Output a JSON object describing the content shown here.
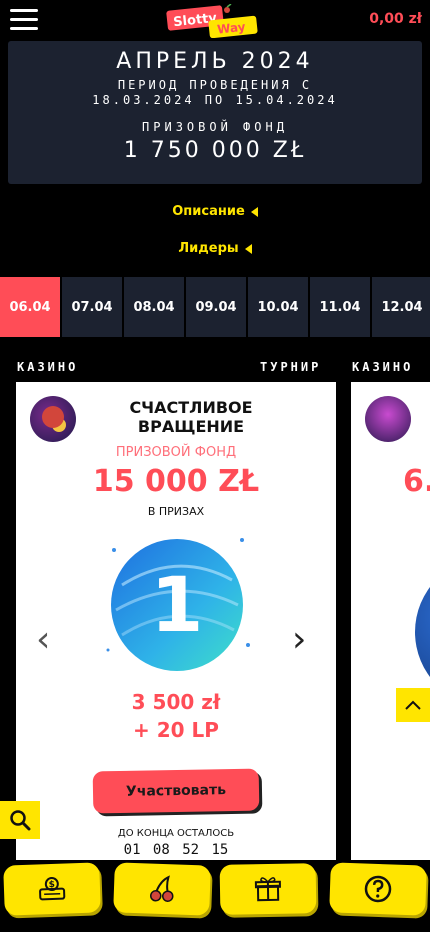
{
  "header": {
    "menu_icon": "hamburger-icon",
    "logo_text": "Slotty Way",
    "balance": "0,00 zł"
  },
  "banner": {
    "month": "АПРЕЛЬ 2024",
    "period_line1": "ПЕРИОД ПРОВЕДЕНИЯ С",
    "period_line2": "18.03.2024 ПО 15.04.2024",
    "fund_label": "ПРИЗОВОЙ ФОНД",
    "fund_value": "1 750 000 ZŁ"
  },
  "links": {
    "description": "Описание",
    "leaders": "Лидеры"
  },
  "date_tabs": [
    {
      "label": "06.04",
      "active": true
    },
    {
      "label": "07.04",
      "active": false
    },
    {
      "label": "08.04",
      "active": false
    },
    {
      "label": "09.04",
      "active": false
    },
    {
      "label": "10.04",
      "active": false
    },
    {
      "label": "11.04",
      "active": false
    },
    {
      "label": "12.04",
      "active": false
    }
  ],
  "card": {
    "category": "КАЗИНО",
    "type": "ТУРНИР",
    "title": "СЧАСТЛИВОЕ ВРАЩЕНИЕ",
    "prize_label": "ПРИЗОВОЙ ФОНД",
    "prize_value": "15 000 ZŁ",
    "in_prizes": "В ПРИЗАХ",
    "place": "1",
    "reward_line1": "3 500 zł",
    "reward_line2": "+ 20 LP",
    "join_button": "Участвовать",
    "time_label": "ДО КОНЦА ОСТАЛОСЬ",
    "countdown": "01 08 52 15"
  },
  "card2": {
    "category": "КАЗИНО",
    "prize_value_partial": "6."
  },
  "bottom_nav": [
    {
      "icon": "cashier-icon"
    },
    {
      "icon": "cherry-icon"
    },
    {
      "icon": "gift-icon"
    },
    {
      "icon": "help-icon"
    }
  ],
  "colors": {
    "accent_red": "#ff4d57",
    "accent_yellow": "#ffe500",
    "panel": "#1c2230"
  }
}
